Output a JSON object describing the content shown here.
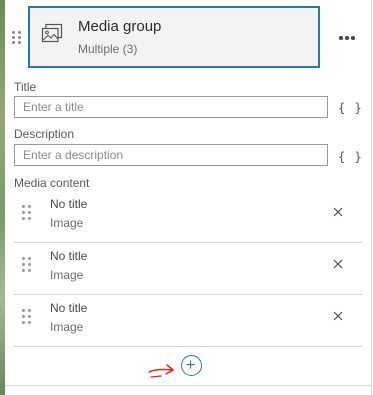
{
  "header": {
    "title": "Media group",
    "subtitle": "Multiple (3)"
  },
  "title_field": {
    "label": "Title",
    "placeholder": "Enter a title",
    "value": ""
  },
  "description_field": {
    "label": "Description",
    "placeholder": "Enter a description",
    "value": ""
  },
  "expression_label": "{ }",
  "media": {
    "label": "Media content",
    "items": [
      {
        "title": "No title",
        "type": "Image"
      },
      {
        "title": "No title",
        "type": "Image"
      },
      {
        "title": "No title",
        "type": "Image"
      }
    ]
  },
  "colors": {
    "accent": "#1f7ab8",
    "annotation": "#e0271f"
  },
  "icons": {
    "card": "image-gallery-icon",
    "menu": "more-horizontal-icon",
    "remove": "close-icon",
    "add": "plus-circle-icon",
    "drag": "drag-handle-icon"
  }
}
